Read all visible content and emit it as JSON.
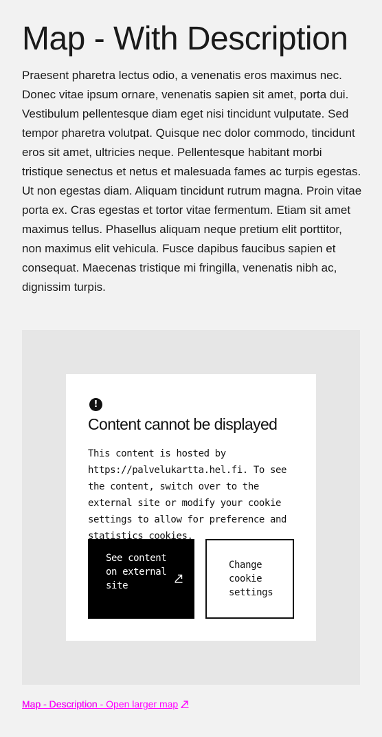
{
  "page": {
    "title": "Map - With Description",
    "description": "Praesent pharetra lectus odio, a venenatis eros maximus nec. Donec vitae ipsum ornare, venenatis sapien sit amet, porta dui. Vestibulum pellentesque diam eget nisi tincidunt vulputate. Sed tempor pharetra volutpat. Quisque nec dolor commodo, tincidunt eros sit amet, ultricies neque. Pellentesque habitant morbi tristique senectus et netus et malesuada fames ac turpis egestas. Ut non egestas diam. Aliquam tincidunt rutrum magna. Proin vitae porta ex. Cras egestas et tortor vitae fermentum. Etiam sit amet maximus tellus. Phasellus aliquam neque pretium elit porttitor, non maximus elit vehicula. Fusce dapibus faucibus sapien et consequat. Maecenas tristique mi fringilla, venenatis nibh ac, dignissim turpis."
  },
  "notice": {
    "icon": "alert-circle-icon",
    "title": "Content cannot be displayed",
    "body": "This content is hosted by https://palvelukartta.hel.fi. To see the content, switch over to the external site or modify your cookie settings to allow for preference and statistics cookies.",
    "external_button": "See content on external site",
    "cookie_button": "Change cookie settings"
  },
  "links": {
    "link_a": "Map - Description",
    "link_b": "Map - Description",
    "link_c": "Map - Description - Open larger map"
  },
  "colors": {
    "background": "#f2f2f2",
    "map_placeholder": "#e6e6e6",
    "link_highlight": "#ff00ff",
    "button_primary": "#000000"
  }
}
